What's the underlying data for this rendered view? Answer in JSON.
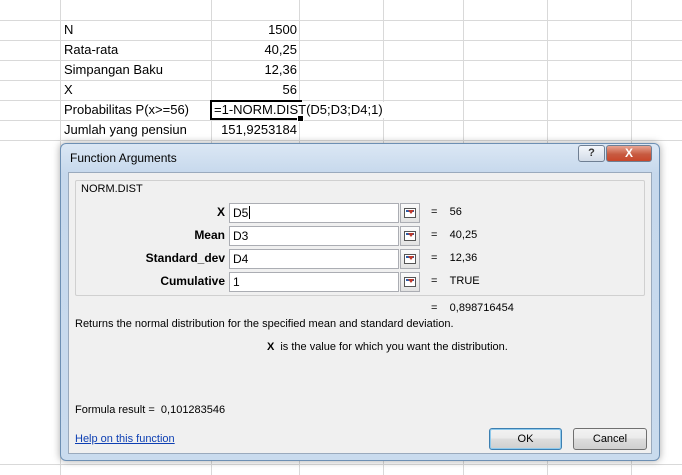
{
  "sheet": {
    "rows": [
      {
        "label": "N",
        "value": "1500"
      },
      {
        "label": "Rata-rata",
        "value": "40,25"
      },
      {
        "label": "Simpangan Baku",
        "value": "12,36"
      },
      {
        "label": "X",
        "value": "56"
      },
      {
        "label": "Probabilitas P(x>=56)",
        "formula": "=1-NORM.DIST(D5;D3;D4;1)"
      },
      {
        "label": "Jumlah yang pensiun",
        "value": "151,9253184"
      }
    ]
  },
  "dialog": {
    "title": "Function Arguments",
    "help_button": "?",
    "close_button": "X",
    "function_name": "NORM.DIST",
    "arguments": [
      {
        "name": "X",
        "value": "D5",
        "result": "56"
      },
      {
        "name": "Mean",
        "value": "D3",
        "result": "40,25"
      },
      {
        "name": "Standard_dev",
        "value": "D4",
        "result": "12,36"
      },
      {
        "name": "Cumulative",
        "value": "1",
        "result": "TRUE"
      }
    ],
    "total_result": "0,898716454",
    "description": "Returns the normal distribution for the specified mean and standard deviation.",
    "argument_help": {
      "name": "X",
      "text": "is the value for which you want the distribution."
    },
    "formula_result": "0,101283546",
    "formula_result_label": "Formula result =",
    "help_link": "Help on this function",
    "ok_label": "OK",
    "cancel_label": "Cancel"
  },
  "colors": {
    "link": "#0d3fb3",
    "close": "#c8462a"
  }
}
